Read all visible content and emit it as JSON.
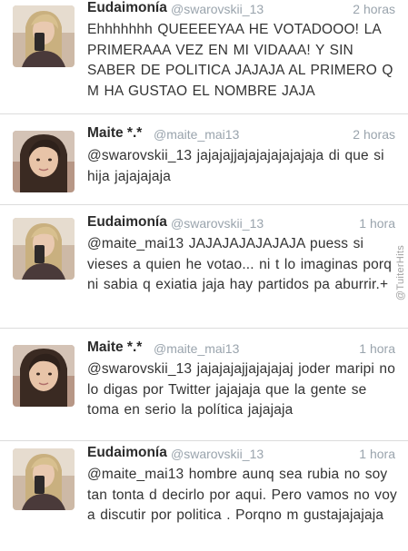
{
  "watermark": "@TuiterHits",
  "tweets": [
    {
      "name": "Eudaimonía",
      "handle": "@swarovskii_13",
      "time": "2 horas",
      "text": "Ehhhhhhh  QUEEEEYAA HE VOTADOOO! LA PRIMERAAA VEZ EN MI VIDAAA! Y SIN SABER DE POLITICA JAJAJA AL PRIMERO Q M HA GUSTAO EL NOMBRE JAJA",
      "avatar": "selfie-avatar-blonde"
    },
    {
      "name": "Maite *.*",
      "handle": "@maite_mai13",
      "time": "2 horas",
      "text": "@swarovskii_13 jajajajjajajajajajajaja di que si hija jajajajaja",
      "avatar": "selfie-avatar-brunette"
    },
    {
      "name": "Eudaimonía",
      "handle": "@swarovskii_13",
      "time": "1 hora",
      "text": "@maite_mai13 JAJAJAJAJAJAJA  puess si vieses a quien he votao... ni t lo imaginas porq ni sabia q exiatia jaja hay partidos pa aburrir.+",
      "avatar": "selfie-avatar-blonde"
    },
    {
      "name": "Maite *.*",
      "handle": "@maite_mai13",
      "time": "1 hora",
      "text": "@swarovskii_13 jajajajajjajajajaj joder maripi no lo digas por Twitter jajajaja que la gente se toma en serio la política jajajaja",
      "avatar": "selfie-avatar-brunette"
    },
    {
      "name": "Eudaimonía",
      "handle": "@swarovskii_13",
      "time": "1 hora",
      "text": "@maite_mai13 hombre aunq sea rubia no soy tan tonta d decirlo por aqui. Pero vamos no voy a discutir por politica . Porqno m gustajajajaja",
      "avatar": "selfie-avatar-blonde"
    }
  ]
}
